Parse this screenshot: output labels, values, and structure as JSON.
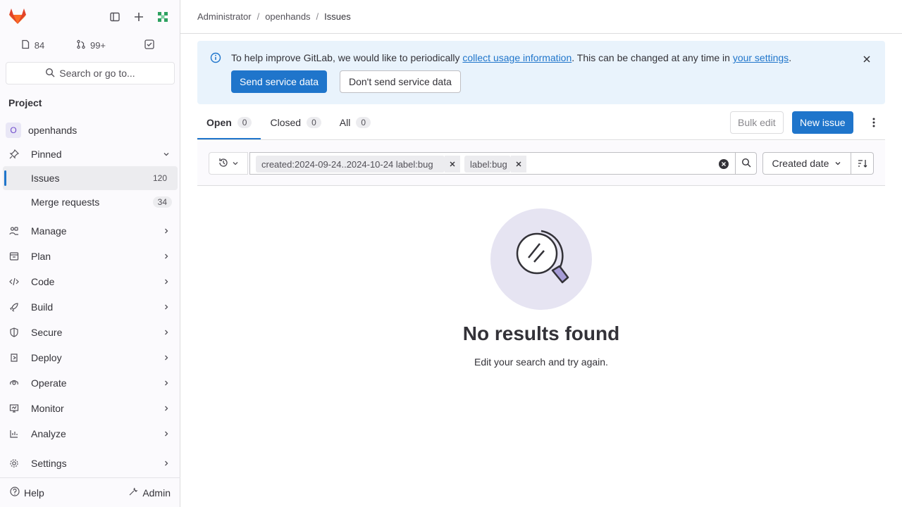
{
  "sidebar": {
    "counts": {
      "issues": "84",
      "merge_requests": "99+"
    },
    "search_label": "Search or go to...",
    "section_title": "Project",
    "project_initial": "O",
    "project_name": "openhands",
    "items": [
      {
        "label": "Pinned"
      },
      {
        "label": "Issues",
        "badge": "120"
      },
      {
        "label": "Merge requests",
        "badge": "34"
      },
      {
        "label": "Manage"
      },
      {
        "label": "Plan"
      },
      {
        "label": "Code"
      },
      {
        "label": "Build"
      },
      {
        "label": "Secure"
      },
      {
        "label": "Deploy"
      },
      {
        "label": "Operate"
      },
      {
        "label": "Monitor"
      },
      {
        "label": "Analyze"
      },
      {
        "label": "Settings"
      }
    ],
    "help_label": "Help",
    "admin_label": "Admin"
  },
  "breadcrumb": {
    "items": [
      "Administrator",
      "openhands",
      "Issues"
    ]
  },
  "banner": {
    "text_before": "To help improve GitLab, we would like to periodically ",
    "link1": "collect usage information",
    "text_middle": ". This can be changed at any time in ",
    "link2": "your settings",
    "text_after": ".",
    "primary_label": "Send service data",
    "secondary_label": "Don't send service data"
  },
  "tabs": [
    {
      "label": "Open",
      "count": "0"
    },
    {
      "label": "Closed",
      "count": "0"
    },
    {
      "label": "All",
      "count": "0"
    }
  ],
  "actions": {
    "bulk_edit": "Bulk edit",
    "new_issue": "New issue"
  },
  "filter": {
    "token1": "created:2024-09-24..2024-10-24 label:bug",
    "token2": "label:bug",
    "sort_label": "Created date"
  },
  "empty_state": {
    "title": "No results found",
    "description": "Edit your search and try again."
  },
  "colors": {
    "accent": "#1f75cb",
    "banner_bg": "#e9f3fc"
  }
}
